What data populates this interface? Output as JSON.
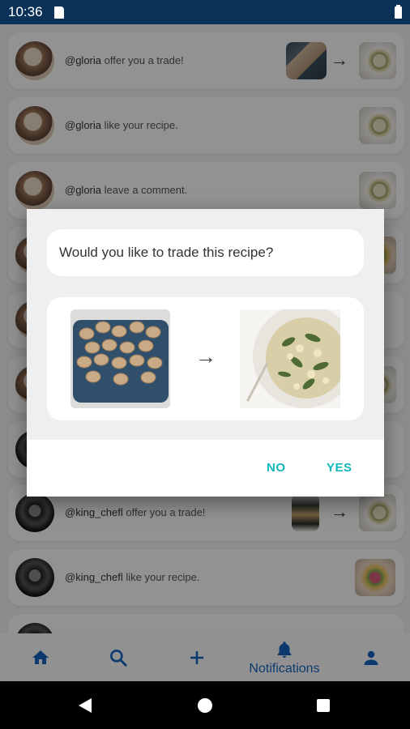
{
  "status_bar": {
    "time": "10:36"
  },
  "notifications": [
    {
      "user": "@gloria",
      "message": "offer you a trade!",
      "type": "trade"
    },
    {
      "user": "@gloria",
      "message": "like your recipe.",
      "type": "like"
    },
    {
      "user": "@gloria",
      "message": "leave a comment.",
      "type": "comment"
    },
    {
      "user": "@king_chefl",
      "message": "offer you a trade!",
      "type": "trade"
    },
    {
      "user": "@king_chefl",
      "message": "like your recipe.",
      "type": "like"
    }
  ],
  "dialog": {
    "question": "Would you like to trade this recipe?",
    "no_label": "NO",
    "yes_label": "YES",
    "arrow": "→",
    "accent_color": "#11b7bd"
  },
  "bottom_nav": {
    "items": [
      {
        "icon": "home-icon"
      },
      {
        "icon": "search-icon"
      },
      {
        "icon": "add-icon"
      },
      {
        "icon": "bell-icon",
        "label": "Notifications",
        "active": true
      },
      {
        "icon": "person-icon"
      }
    ],
    "color": "#1565c0"
  }
}
